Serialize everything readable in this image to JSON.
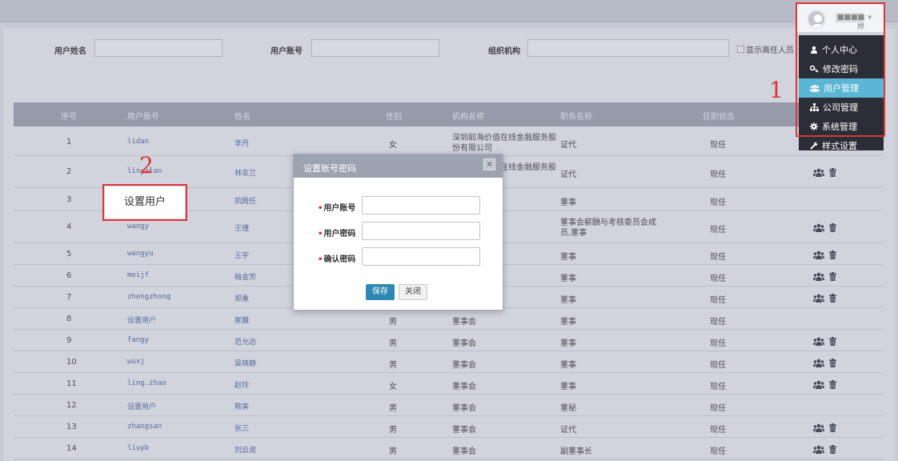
{
  "search": {
    "user_name_label": "用户姓名",
    "user_account_label": "用户账号",
    "org_label": "组织机构",
    "show_resigned_label": "显示离任人员"
  },
  "table": {
    "headers": [
      "序号",
      "用户账号",
      "姓名",
      "性别",
      "机构名称",
      "职务名称",
      "任职状态"
    ],
    "rows": [
      {
        "idx": "1",
        "account": "lidan",
        "name": "李丹",
        "gender": "女",
        "org": "深圳前海价值在线金融服务股份有限公司",
        "title": "证代",
        "status": "现任",
        "ops": false
      },
      {
        "idx": "2",
        "account": "linyalan",
        "name": "林亚兰",
        "gender": "",
        "org": "深圳前海价值在线金融服务股份",
        "title": "证代",
        "status": "现任",
        "ops": true
      },
      {
        "idx": "3",
        "account": "",
        "name": "凯腾任",
        "gender": "",
        "org": "",
        "title": "董事",
        "status": "现任",
        "ops": false
      },
      {
        "idx": "4",
        "account": "wangy",
        "name": "王瑾",
        "gender": "",
        "org": "核委员会,董",
        "title": "董事会薪酬与考核委员会成员,董事",
        "status": "现任",
        "ops": true
      },
      {
        "idx": "5",
        "account": "wangyu",
        "name": "王宇",
        "gender": "",
        "org": "",
        "title": "董事",
        "status": "现任",
        "ops": true
      },
      {
        "idx": "6",
        "account": "meijf",
        "name": "梅金芳",
        "gender": "",
        "org": "",
        "title": "董事",
        "status": "现任",
        "ops": true
      },
      {
        "idx": "7",
        "account": "zhengzhong",
        "name": "郑重",
        "gender": "",
        "org": "",
        "title": "董事",
        "status": "现任",
        "ops": true
      },
      {
        "idx": "8",
        "account": "设置用户",
        "name": "崔巍",
        "gender": "男",
        "org": "董事会",
        "title": "董事",
        "status": "现任",
        "ops": false
      },
      {
        "idx": "9",
        "account": "fangy",
        "name": "范允远",
        "gender": "男",
        "org": "董事会",
        "title": "董事",
        "status": "现任",
        "ops": true
      },
      {
        "idx": "10",
        "account": "wuxj",
        "name": "吴晓静",
        "gender": "男",
        "org": "董事会",
        "title": "董事",
        "status": "现任",
        "ops": true
      },
      {
        "idx": "11",
        "account": "ling.zhao",
        "name": "赵玲",
        "gender": "女",
        "org": "董事会",
        "title": "董事",
        "status": "现任",
        "ops": true
      },
      {
        "idx": "12",
        "account": "设置用户",
        "name": "熊寅",
        "gender": "男",
        "org": "董事会",
        "title": "董秘",
        "status": "现任",
        "ops": false
      },
      {
        "idx": "13",
        "account": "zhangsan",
        "name": "张三",
        "gender": "男",
        "org": "董事会",
        "title": "证代",
        "status": "现任",
        "ops": true
      },
      {
        "idx": "14",
        "account": "liuyb",
        "name": "刘云波",
        "gender": "男",
        "org": "董事会",
        "title": "副董事长",
        "status": "现任",
        "ops": true
      }
    ]
  },
  "modal": {
    "title": "设置账号密码",
    "close_icon": "×",
    "account_label": "用户账号",
    "password_label": "用户密码",
    "confirm_label": "确认密码",
    "required_mark": "•",
    "save_label": "保存",
    "close_label": "关闭"
  },
  "user_menu": {
    "username": "■■■■婷",
    "items": [
      {
        "label": "个人中心",
        "icon": "user-icon"
      },
      {
        "label": "修改密码",
        "icon": "key-icon"
      },
      {
        "label": "用户管理",
        "icon": "users-icon",
        "active": true
      },
      {
        "label": "公司管理",
        "icon": "sitemap-icon"
      },
      {
        "label": "系统管理",
        "icon": "gear-icon"
      },
      {
        "label": "样式设置",
        "icon": "wrench-icon"
      }
    ]
  },
  "annotations": {
    "num1": "1",
    "num2": "2",
    "callout": "设置用户"
  },
  "colors": {
    "accent": "#5bb6d6",
    "primary_button": "#2f88b3",
    "annotation_red": "#e03434",
    "menu_bg": "#2b2e36"
  }
}
